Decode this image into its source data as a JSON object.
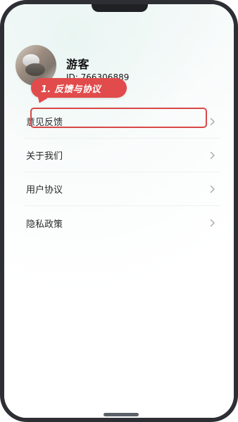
{
  "profile": {
    "name": "游客",
    "id": "ID: 766306889"
  },
  "annotation": {
    "label": "1. 反馈与协议",
    "color": "#e14b4b"
  },
  "menu": {
    "items": [
      {
        "label": "意见反馈",
        "icon": "chevron-right-icon"
      },
      {
        "label": "关于我们",
        "icon": "chevron-right-icon"
      },
      {
        "label": "用户协议",
        "icon": "chevron-right-icon"
      },
      {
        "label": "隐私政策",
        "icon": "chevron-right-icon"
      }
    ]
  }
}
